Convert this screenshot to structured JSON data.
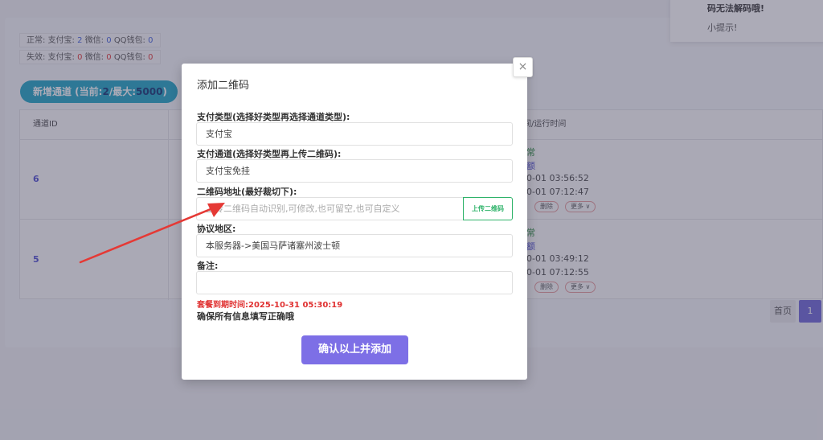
{
  "background": {
    "stats_normal": {
      "label": "正常:",
      "alipay_label": "支付宝:",
      "alipay": "2",
      "wechat_label": "微信:",
      "wechat": "0",
      "qq_label": "QQ钱包:",
      "qq": "0"
    },
    "stats_invalid": {
      "label": "失效:",
      "alipay_label": "支付宝:",
      "alipay": "0",
      "wechat_label": "微信:",
      "wechat": "0",
      "qq_label": "QQ钱包:",
      "qq": "0"
    },
    "add_channel": {
      "prefix": "新增通道 (当前:",
      "current": "2",
      "sep": "/最大:",
      "max": "5000",
      "suffix": ")"
    },
    "table": {
      "col_id": "通道ID",
      "col_time": "间/运行时间",
      "rows": [
        {
          "id": "6",
          "status": "常",
          "link": "额",
          "time1": "0-01 03:56:52",
          "time2": "0-01 07:12:47",
          "delete": "删除",
          "more": "更多 ∨"
        },
        {
          "id": "5",
          "status": "常",
          "link": "额",
          "time1": "0-01 03:49:12",
          "time2": "0-01 07:12:55",
          "delete": "删除",
          "more": "更多 ∨"
        }
      ]
    },
    "pager": {
      "home": "首页",
      "page": "1"
    }
  },
  "toast": {
    "line1": "码无法解码哦!",
    "line2": "小提示!"
  },
  "modal": {
    "title": "添加二维码",
    "close": "×",
    "pay_type": {
      "label": "支付类型(选择好类型再选择通道类型):",
      "value": "支付宝"
    },
    "pay_channel": {
      "label": "支付通道(选择好类型再上传二维码):",
      "value": "支付宝免挂"
    },
    "qr_address": {
      "label": "二维码地址(最好裁切下):",
      "placeholder": "上传二维码自动识别,可修改,也可留空,也可自定义",
      "upload": "上传二维码"
    },
    "region": {
      "label": "协议地区:",
      "value": "本服务器->美国马萨诸塞州波士顿"
    },
    "remark": {
      "label": "备注:",
      "value": ""
    },
    "expire": "套餐到期时间:2025-10-31 05:30:19",
    "ensure": "确保所有信息填写正确哦",
    "submit": "确认以上并添加"
  },
  "colors": {
    "accent": "#7d6fe6",
    "upload_green": "#2fb36a",
    "warning_red": "#e03131",
    "add_channel_teal": "#1aa3c3",
    "arrow_red": "#e53935"
  }
}
